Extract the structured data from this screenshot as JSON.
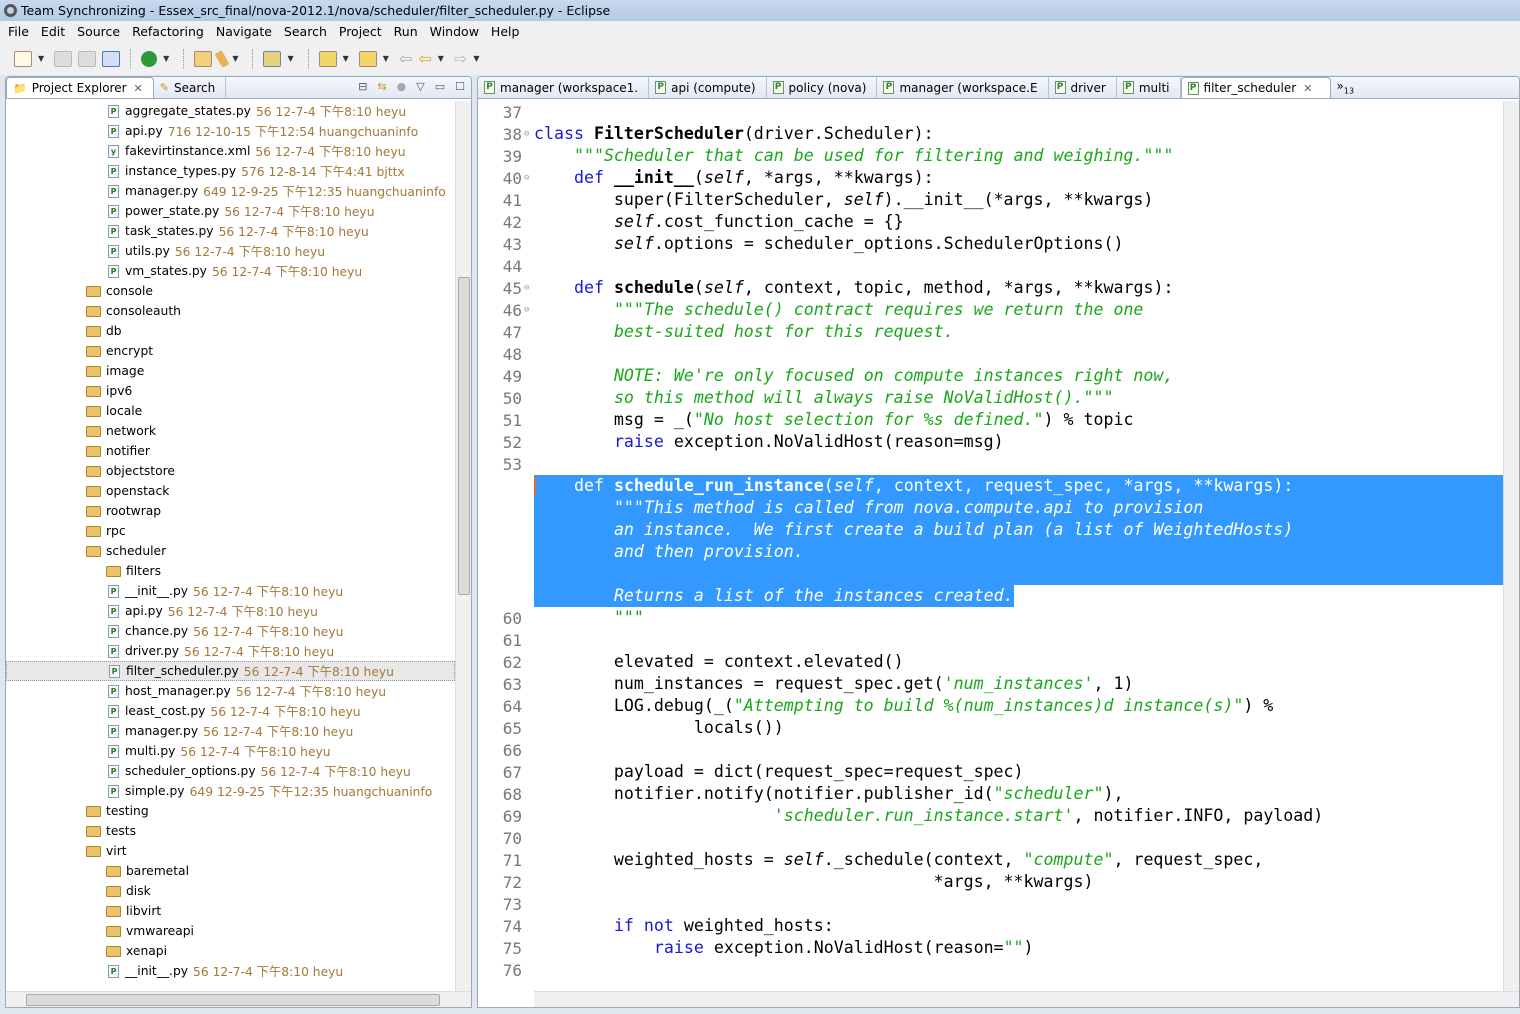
{
  "window": {
    "title": "Team Synchronizing - Essex_src_final/nova-2012.1/nova/scheduler/filter_scheduler.py - Eclipse"
  },
  "menu": [
    "File",
    "Edit",
    "Source",
    "Refactoring",
    "Navigate",
    "Search",
    "Project",
    "Run",
    "Window",
    "Help"
  ],
  "left_panel": {
    "tabs": [
      {
        "label": "Project Explorer",
        "icon": "folder-icon",
        "active": true
      },
      {
        "label": "Search",
        "icon": "search-flashlight-icon",
        "active": false
      }
    ],
    "tree": [
      {
        "level": 2,
        "kind": "file",
        "name": "aggregate_states.py",
        "meta": "56  12-7-4 下午8:10  heyu"
      },
      {
        "level": 2,
        "kind": "file",
        "name": "api.py",
        "meta": "716  12-10-15 下午12:54  huangchuaninfo"
      },
      {
        "level": 2,
        "kind": "xml",
        "name": "fakevirtinstance.xml",
        "meta": "56  12-7-4 下午8:10  heyu"
      },
      {
        "level": 2,
        "kind": "file",
        "name": "instance_types.py",
        "meta": "576  12-8-14 下午4:41  bjttx"
      },
      {
        "level": 2,
        "kind": "file",
        "name": "manager.py",
        "meta": "649  12-9-25 下午12:35  huangchuaninfo"
      },
      {
        "level": 2,
        "kind": "file",
        "name": "power_state.py",
        "meta": "56  12-7-4 下午8:10  heyu"
      },
      {
        "level": 2,
        "kind": "file",
        "name": "task_states.py",
        "meta": "56  12-7-4 下午8:10  heyu"
      },
      {
        "level": 2,
        "kind": "file",
        "name": "utils.py",
        "meta": "56  12-7-4 下午8:10  heyu"
      },
      {
        "level": 2,
        "kind": "file",
        "name": "vm_states.py",
        "meta": "56  12-7-4 下午8:10  heyu"
      },
      {
        "level": 1,
        "kind": "folder",
        "name": "console"
      },
      {
        "level": 1,
        "kind": "folder",
        "name": "consoleauth"
      },
      {
        "level": 1,
        "kind": "folder",
        "name": "db"
      },
      {
        "level": 1,
        "kind": "folder",
        "name": "encrypt"
      },
      {
        "level": 1,
        "kind": "folder",
        "name": "image"
      },
      {
        "level": 1,
        "kind": "folder",
        "name": "ipv6"
      },
      {
        "level": 1,
        "kind": "folder",
        "name": "locale"
      },
      {
        "level": 1,
        "kind": "folder",
        "name": "network"
      },
      {
        "level": 1,
        "kind": "folder",
        "name": "notifier"
      },
      {
        "level": 1,
        "kind": "folder",
        "name": "objectstore"
      },
      {
        "level": 1,
        "kind": "folder",
        "name": "openstack"
      },
      {
        "level": 1,
        "kind": "folder",
        "name": "rootwrap"
      },
      {
        "level": 1,
        "kind": "folder",
        "name": "rpc"
      },
      {
        "level": 1,
        "kind": "folder",
        "name": "scheduler"
      },
      {
        "level": 2,
        "kind": "folder",
        "name": "filters"
      },
      {
        "level": 2,
        "kind": "file",
        "name": "__init__.py",
        "meta": "56  12-7-4 下午8:10  heyu"
      },
      {
        "level": 2,
        "kind": "file",
        "name": "api.py",
        "meta": "56  12-7-4 下午8:10  heyu"
      },
      {
        "level": 2,
        "kind": "file",
        "name": "chance.py",
        "meta": "56  12-7-4 下午8:10  heyu"
      },
      {
        "level": 2,
        "kind": "file",
        "name": "driver.py",
        "meta": "56  12-7-4 下午8:10  heyu"
      },
      {
        "level": 2,
        "kind": "file",
        "name": "filter_scheduler.py",
        "meta": "56  12-7-4 下午8:10  heyu",
        "selected": true
      },
      {
        "level": 2,
        "kind": "file",
        "name": "host_manager.py",
        "meta": "56  12-7-4 下午8:10  heyu"
      },
      {
        "level": 2,
        "kind": "file",
        "name": "least_cost.py",
        "meta": "56  12-7-4 下午8:10  heyu"
      },
      {
        "level": 2,
        "kind": "file",
        "name": "manager.py",
        "meta": "56  12-7-4 下午8:10  heyu"
      },
      {
        "level": 2,
        "kind": "file",
        "name": "multi.py",
        "meta": "56  12-7-4 下午8:10  heyu"
      },
      {
        "level": 2,
        "kind": "file",
        "name": "scheduler_options.py",
        "meta": "56  12-7-4 下午8:10  heyu"
      },
      {
        "level": 2,
        "kind": "file",
        "name": "simple.py",
        "meta": "649  12-9-25 下午12:35  huangchuaninfo"
      },
      {
        "level": 1,
        "kind": "folder",
        "name": "testing"
      },
      {
        "level": 1,
        "kind": "folder",
        "name": "tests"
      },
      {
        "level": 1,
        "kind": "folder",
        "name": "virt"
      },
      {
        "level": 2,
        "kind": "folder",
        "name": "baremetal"
      },
      {
        "level": 2,
        "kind": "folder",
        "name": "disk"
      },
      {
        "level": 2,
        "kind": "folder",
        "name": "libvirt"
      },
      {
        "level": 2,
        "kind": "folder",
        "name": "vmwareapi"
      },
      {
        "level": 2,
        "kind": "folder",
        "name": "xenapi"
      },
      {
        "level": 2,
        "kind": "file",
        "name": "__init__.py",
        "meta": "56  12-7-4 下午8:10  heyu"
      }
    ]
  },
  "editor": {
    "tabs": [
      {
        "label": "manager (workspace1."
      },
      {
        "label": "api (compute)"
      },
      {
        "label": "policy (nova)"
      },
      {
        "label": "manager (workspace.E"
      },
      {
        "label": "driver"
      },
      {
        "label": "multi"
      },
      {
        "label": "filter_scheduler",
        "active": true
      }
    ],
    "overflow_count": "13",
    "first_line": 37,
    "selection": {
      "from_line": 54,
      "to_line": 59
    },
    "fold_lines": [
      38,
      40,
      45,
      46,
      54,
      55
    ],
    "lines": [
      [],
      [
        [
          "kw",
          "class"
        ],
        [
          "",
          "",
          " "
        ],
        [
          "fn",
          "FilterScheduler"
        ],
        [
          "",
          "(driver.Scheduler):"
        ]
      ],
      [
        [
          "",
          "    "
        ],
        [
          "doc",
          "\"\"\"Scheduler that can be used for filtering and weighing.\"\"\""
        ]
      ],
      [
        [
          "",
          "    "
        ],
        [
          "kw",
          "def"
        ],
        [
          "",
          " "
        ],
        [
          "fn",
          "__init__"
        ],
        [
          "",
          "("
        ],
        [
          "slf",
          "self"
        ],
        [
          "",
          ", *args, **kwargs):"
        ]
      ],
      [
        [
          "",
          "        super(FilterScheduler, "
        ],
        [
          "slf",
          "self"
        ],
        [
          "",
          ").__init__(*args, **kwargs)"
        ]
      ],
      [
        [
          "",
          "        "
        ],
        [
          "slf",
          "self"
        ],
        [
          "",
          ".cost_function_cache = {}"
        ]
      ],
      [
        [
          "",
          "        "
        ],
        [
          "slf",
          "self"
        ],
        [
          "",
          ".options = scheduler_options.SchedulerOptions()"
        ]
      ],
      [],
      [
        [
          "",
          "    "
        ],
        [
          "kw",
          "def"
        ],
        [
          "",
          " "
        ],
        [
          "fn",
          "schedule"
        ],
        [
          "",
          "("
        ],
        [
          "slf",
          "self"
        ],
        [
          "",
          ", context, topic, method, *args, **kwargs):"
        ]
      ],
      [
        [
          "",
          "        "
        ],
        [
          "doc",
          "\"\"\"The schedule() contract requires we return the one"
        ]
      ],
      [
        [
          "",
          "        "
        ],
        [
          "doc",
          "best-suited host for this request."
        ]
      ],
      [],
      [
        [
          "",
          "        "
        ],
        [
          "doc",
          "NOTE: We're only focused on compute instances right now,"
        ]
      ],
      [
        [
          "",
          "        "
        ],
        [
          "doc",
          "so this method will always raise NoValidHost().\"\"\""
        ]
      ],
      [
        [
          "",
          "        msg = _("
        ],
        [
          "str",
          "\"No host selection for %s defined.\""
        ],
        [
          "",
          ") % topic"
        ]
      ],
      [
        [
          "",
          "        "
        ],
        [
          "kw",
          "raise"
        ],
        [
          "",
          " exception.NoValidHost(reason=msg)"
        ]
      ],
      [],
      [
        [
          "",
          "    "
        ],
        [
          "kw",
          "def"
        ],
        [
          "",
          " "
        ],
        [
          "fn",
          "schedule_run_instance"
        ],
        [
          "",
          "("
        ],
        [
          "slf",
          "self"
        ],
        [
          "",
          ", context, request_spec, *args, **kwargs):"
        ]
      ],
      [
        [
          "",
          "        "
        ],
        [
          "doc",
          "\"\"\"This method is called from nova.compute.api to provision"
        ]
      ],
      [
        [
          "",
          "        "
        ],
        [
          "doc",
          "an instance.  We first create a build plan (a list of WeightedHosts)"
        ]
      ],
      [
        [
          "",
          "        "
        ],
        [
          "doc",
          "and then provision."
        ]
      ],
      [],
      [
        [
          "",
          "        "
        ],
        [
          "doc",
          "Returns a list of the instances created."
        ]
      ],
      [
        [
          "",
          "        "
        ],
        [
          "doc",
          "\"\"\""
        ]
      ],
      [],
      [
        [
          "",
          "        elevated = context.elevated()"
        ]
      ],
      [
        [
          "",
          "        num_instances = request_spec.get("
        ],
        [
          "str",
          "'num_instances'"
        ],
        [
          "",
          ", 1)"
        ]
      ],
      [
        [
          "",
          "        LOG.debug(_("
        ],
        [
          "str",
          "\"Attempting to build %(num_instances)d instance(s)\""
        ],
        [
          "",
          ") %"
        ]
      ],
      [
        [
          "",
          "                locals())"
        ]
      ],
      [],
      [
        [
          "",
          "        payload = dict(request_spec=request_spec)"
        ]
      ],
      [
        [
          "",
          "        notifier.notify(notifier.publisher_id("
        ],
        [
          "str",
          "\"scheduler\""
        ],
        [
          "",
          "),"
        ]
      ],
      [
        [
          "",
          "                        "
        ],
        [
          "str",
          "'scheduler.run_instance.start'"
        ],
        [
          "",
          ", notifier.INFO, payload)"
        ]
      ],
      [],
      [
        [
          "",
          "        weighted_hosts = "
        ],
        [
          "slf",
          "self"
        ],
        [
          "",
          "._schedule(context, "
        ],
        [
          "str",
          "\"compute\""
        ],
        [
          "",
          ", request_spec,"
        ]
      ],
      [
        [
          "",
          "                                        *args, **kwargs)"
        ]
      ],
      [],
      [
        [
          "",
          "        "
        ],
        [
          "kw",
          "if not"
        ],
        [
          "",
          " weighted_hosts:"
        ]
      ],
      [
        [
          "",
          "            "
        ],
        [
          "kw",
          "raise"
        ],
        [
          "",
          " exception.NoValidHost(reason="
        ],
        [
          "str",
          "\"\""
        ],
        [
          "",
          ")"
        ]
      ],
      []
    ]
  },
  "colors": {
    "selection": "#3399ff",
    "keyword": "#1818d8",
    "string": "#1aa81a"
  }
}
